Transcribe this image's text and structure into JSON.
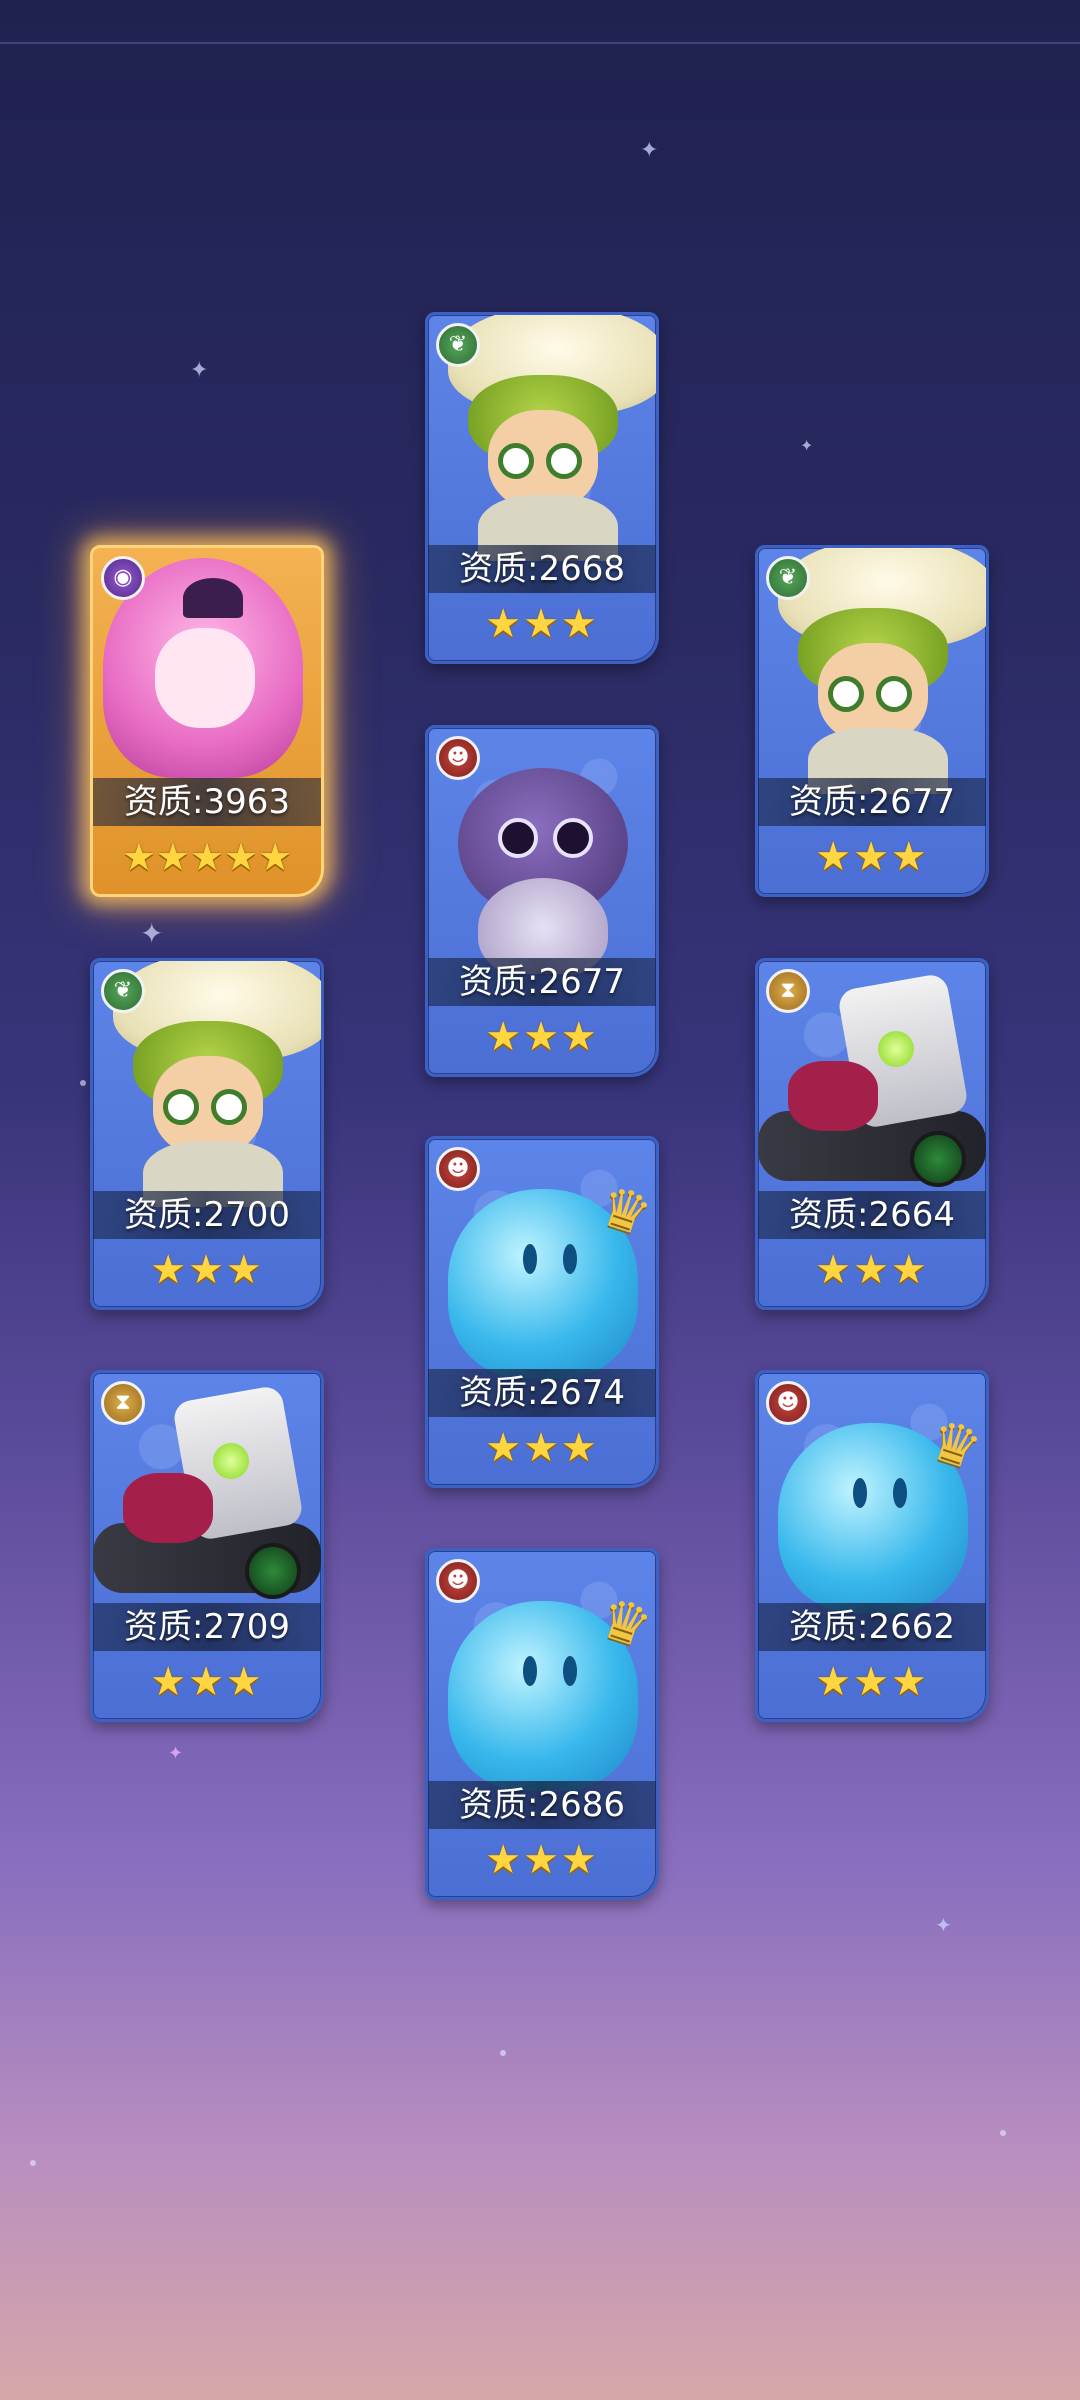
{
  "cards": [
    {
      "quality_label": "资质:3963",
      "stars": "★★★★★",
      "star_count": 5,
      "element": "dark",
      "character": "pink-haired-demon-girl",
      "highlighted": true
    },
    {
      "quality_label": "资质:2668",
      "stars": "★★★",
      "star_count": 3,
      "element": "nature",
      "character": "mushroom-goggles"
    },
    {
      "quality_label": "资质:2677",
      "stars": "★★★",
      "star_count": 3,
      "element": "nature",
      "character": "mushroom-goggles"
    },
    {
      "quality_label": "资质:2677",
      "stars": "★★★",
      "star_count": 3,
      "element": "fire",
      "character": "purple-spider-egg"
    },
    {
      "quality_label": "资质:2700",
      "stars": "★★★",
      "star_count": 3,
      "element": "nature",
      "character": "mushroom-goggles"
    },
    {
      "quality_label": "资质:2664",
      "stars": "★★★",
      "star_count": 3,
      "element": "light",
      "character": "white-golem"
    },
    {
      "quality_label": "资质:2674",
      "stars": "★★★",
      "star_count": 3,
      "element": "fire",
      "character": "blue-slime-king"
    },
    {
      "quality_label": "资质:2709",
      "stars": "★★★",
      "star_count": 3,
      "element": "light",
      "character": "white-golem"
    },
    {
      "quality_label": "资质:2662",
      "stars": "★★★",
      "star_count": 3,
      "element": "fire",
      "character": "blue-slime-king"
    },
    {
      "quality_label": "资质:2686",
      "stars": "★★★",
      "star_count": 3,
      "element": "fire",
      "character": "blue-slime-king"
    }
  ],
  "element_icons": {
    "nature": "leaf-icon",
    "fire": "demon-mask-icon",
    "light": "hourglass-icon",
    "dark": "eye-icon"
  },
  "colors": {
    "card_blue": "#4b6fd4",
    "card_gold": "#e09229",
    "star": "#ffd642"
  }
}
